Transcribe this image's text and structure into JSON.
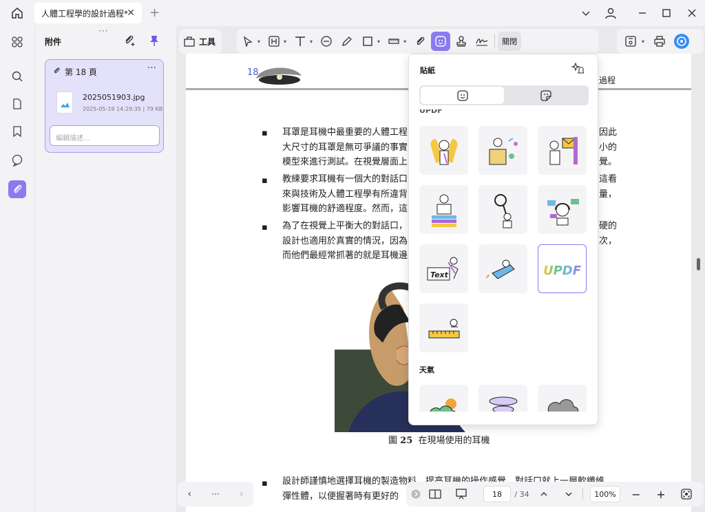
{
  "tab": {
    "title": "人體工程學的設計過程*"
  },
  "attachments": {
    "title": "附件",
    "card": {
      "page_label": "第 18 頁",
      "file_name": "2025051903.jpg",
      "file_meta": "2025-05-19 14:29:35 | 79 KB",
      "desc_placeholder": "編輯描述..."
    }
  },
  "toolbar": {
    "tools_label": "工具",
    "close_label": "關閉"
  },
  "document": {
    "page_number": "18",
    "section_title": "過程",
    "paragraphs": [
      {
        "lines": [
          "耳罩是耳機中最重要的人體工程",
          "大尺寸的耳罩是無可爭議的事實",
          "模型來進行測試。在視覺層面上"
        ],
        "right": [
          "因此",
          "小的",
          "覺。"
        ]
      },
      {
        "lines": [
          "教練要求耳機有一個大的對話口",
          "來與技術及人體工程學有所違背",
          "影響耳機的舒適程度。然而，這"
        ],
        "right": [
          "這看",
          "量，",
          ""
        ]
      },
      {
        "lines": [
          "為了在視覺上平衡大的對話口，",
          "設計也適用於真實的情況，因為",
          "而他們最經常抓著的就是耳機邊"
        ],
        "right": [
          "硬的",
          "次，",
          ""
        ]
      }
    ],
    "caption_prefix": "圖",
    "caption_num": "25",
    "caption_text": "在現場使用的耳機",
    "bottom_lines": [
      "設計師謹慎地選擇耳機的製造物料，提高耳機的操作感覺。對話口就上一層軟纖維",
      "彈性體，以便握著時有更好的"
    ]
  },
  "stickers": {
    "title": "貼紙",
    "section_partial": "UPDF",
    "section_weather": "天氣",
    "updf_text": "UPDF",
    "text_sticker": "Text"
  },
  "pagebar": {
    "current_page": "18",
    "total_pages": "/ 34",
    "zoom": "100%"
  },
  "colors": {
    "accent": "#8a7bf0",
    "accent_light": "#e4e1fb"
  }
}
